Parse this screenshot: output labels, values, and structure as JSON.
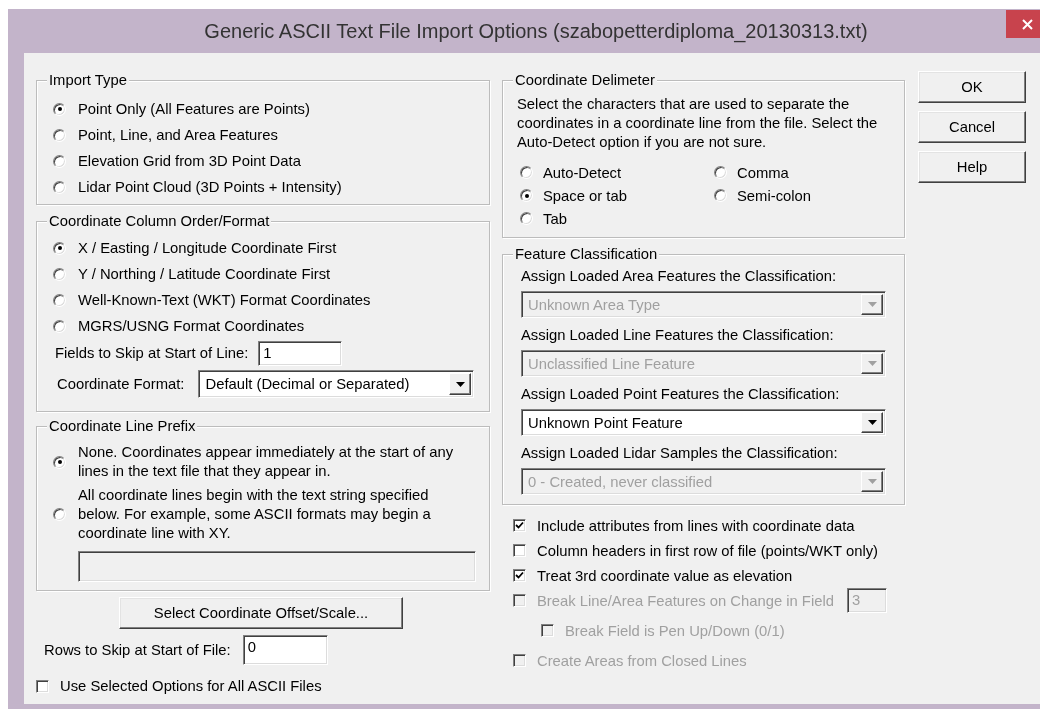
{
  "window": {
    "title": "Generic ASCII Text File Import Options (szabopetterdiploma_20130313.txt)"
  },
  "import_type": {
    "title": "Import Type",
    "options": [
      {
        "label": "Point Only (All Features are Points)",
        "selected": true
      },
      {
        "label": "Point, Line, and Area Features",
        "selected": false
      },
      {
        "label": "Elevation Grid from 3D Point Data",
        "selected": false
      },
      {
        "label": "Lidar Point Cloud (3D Points + Intensity)",
        "selected": false
      }
    ]
  },
  "column_order": {
    "title": "Coordinate Column Order/Format",
    "options": [
      {
        "label": "X / Easting / Longitude Coordinate First",
        "selected": true
      },
      {
        "label": "Y / Northing / Latitude Coordinate First",
        "selected": false
      },
      {
        "label": "Well-Known-Text (WKT) Format Coordinates",
        "selected": false
      },
      {
        "label": "MGRS/USNG Format Coordinates",
        "selected": false
      }
    ],
    "fields_to_skip": {
      "label": "Fields to Skip at Start of Line:",
      "value": "1"
    },
    "coordinate_format": {
      "label": "Coordinate Format:",
      "value": "Default (Decimal or Separated)"
    }
  },
  "line_prefix": {
    "title": "Coordinate Line Prefix",
    "options": [
      {
        "label": "None. Coordinates appear immediately at the start of any lines in the text file that they appear in.",
        "selected": true
      },
      {
        "label": "All coordinate lines begin with the text string specified below. For example, some ASCII formats may begin a coordinate line with XY.",
        "selected": false
      }
    ],
    "prefix_field": {
      "disabled": true
    }
  },
  "offset_button": "Select Coordinate Offset/Scale...",
  "rows_to_skip": {
    "label": "Rows to Skip at Start of File:",
    "value": "0"
  },
  "use_for_all": {
    "label": "Use Selected Options for All ASCII Files",
    "checked": false
  },
  "delimiter": {
    "title": "Coordinate Delimeter",
    "description": "Select the characters that are used to separate the coordinates in a coordinate line from the file. Select the Auto-Detect option if you are not sure.",
    "options": [
      {
        "label": "Auto-Detect",
        "selected": false
      },
      {
        "label": "Space or tab",
        "selected": true
      },
      {
        "label": "Tab",
        "selected": false
      },
      {
        "label": "Comma",
        "selected": false
      },
      {
        "label": "Semi-colon",
        "selected": false
      }
    ]
  },
  "feature_classification": {
    "title": "Feature Classification",
    "rows": [
      {
        "label": "Assign Loaded Area Features the Classification:",
        "value": "Unknown Area Type",
        "disabled": true
      },
      {
        "label": "Assign Loaded Line Features the Classification:",
        "value": "Unclassified Line Feature",
        "disabled": true
      },
      {
        "label": "Assign Loaded Point Features the Classification:",
        "value": "Unknown Point Feature",
        "disabled": false
      },
      {
        "label": "Assign Loaded Lidar Samples the Classification:",
        "value": "0 - Created, never classified",
        "disabled": true
      }
    ]
  },
  "options": [
    {
      "label": "Include attributes from lines with coordinate data",
      "checked": true,
      "disabled": false
    },
    {
      "label": "Column headers in first row of file (points/WKT only)",
      "checked": false,
      "disabled": false
    },
    {
      "label": "Treat 3rd coordinate value as elevation",
      "checked": true,
      "disabled": false
    },
    {
      "label": "Break Line/Area Features on Change in Field",
      "checked": false,
      "disabled": true,
      "field": "3",
      "children": [
        {
          "label": "Break Field is Pen Up/Down (0/1)",
          "checked": false,
          "disabled": true
        }
      ]
    },
    {
      "label": "Create Areas from Closed Lines",
      "checked": false,
      "disabled": true
    }
  ],
  "buttons": [
    "OK",
    "Cancel",
    "Help"
  ]
}
